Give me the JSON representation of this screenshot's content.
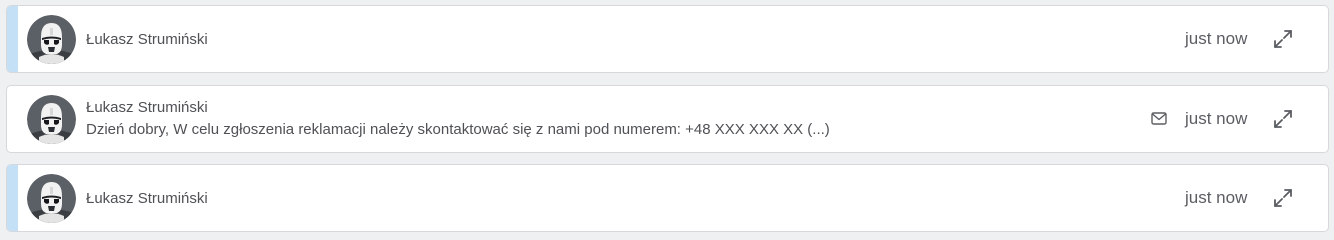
{
  "notifications": [
    {
      "author": "Łukasz Strumiński",
      "preview": "",
      "time": "just now",
      "unread": true,
      "has_mail_icon": false,
      "avatar_icon": "stormtrooper-avatar-icon",
      "expand_icon": "expand-icon"
    },
    {
      "author": "Łukasz Strumiński",
      "preview": "Dzień dobry, W celu zgłoszenia reklamacji należy skontaktować się z nami pod numerem: +48 XXX XXX XX (...)",
      "time": "just now",
      "unread": false,
      "has_mail_icon": true,
      "avatar_icon": "stormtrooper-avatar-icon",
      "expand_icon": "expand-icon"
    },
    {
      "author": "Łukasz Strumiński",
      "preview": "",
      "time": "just now",
      "unread": true,
      "has_mail_icon": false,
      "avatar_icon": "stormtrooper-avatar-icon",
      "expand_icon": "expand-icon"
    }
  ],
  "colors": {
    "background": "#eff0f2",
    "card": "#ffffff",
    "card_border": "#d6d8dc",
    "unread_accent": "#c3e0f6",
    "text": "#4e5155",
    "icon": "#5a5d62"
  }
}
